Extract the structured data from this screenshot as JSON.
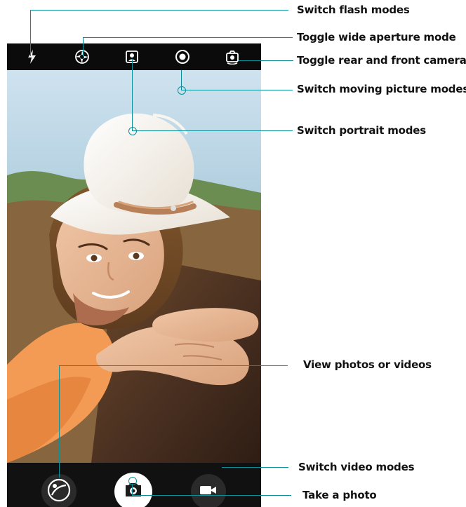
{
  "camera_ui": {
    "top_controls": {
      "flash_icon": "flash-icon",
      "aperture_icon": "aperture-icon",
      "portrait_icon": "portrait-mode-icon",
      "moving_picture_icon": "moving-picture-icon",
      "switch_camera_icon": "switch-camera-icon"
    },
    "bottom_controls": {
      "gallery_icon": "gallery-icon",
      "shutter_icon": "camera-icon",
      "video_icon": "video-icon"
    },
    "navigation": {
      "back_icon": "back-triangle-icon",
      "home_icon": "home-circle-icon",
      "recents_icon": "recents-square-icon"
    }
  },
  "labels": {
    "flash": "Switch flash modes",
    "aperture": "Toggle wide aperture mode",
    "camera_switch": "Toggle rear and front camera",
    "moving_picture": "Switch moving picture modes",
    "portrait": "Switch portrait modes",
    "gallery": "View photos or videos",
    "video": "Switch video modes",
    "photo": "Take a photo"
  },
  "colors": {
    "callout": "#0a8f99",
    "shutter_bg": "#ffffff",
    "dark_button": "#2a2a2a"
  }
}
